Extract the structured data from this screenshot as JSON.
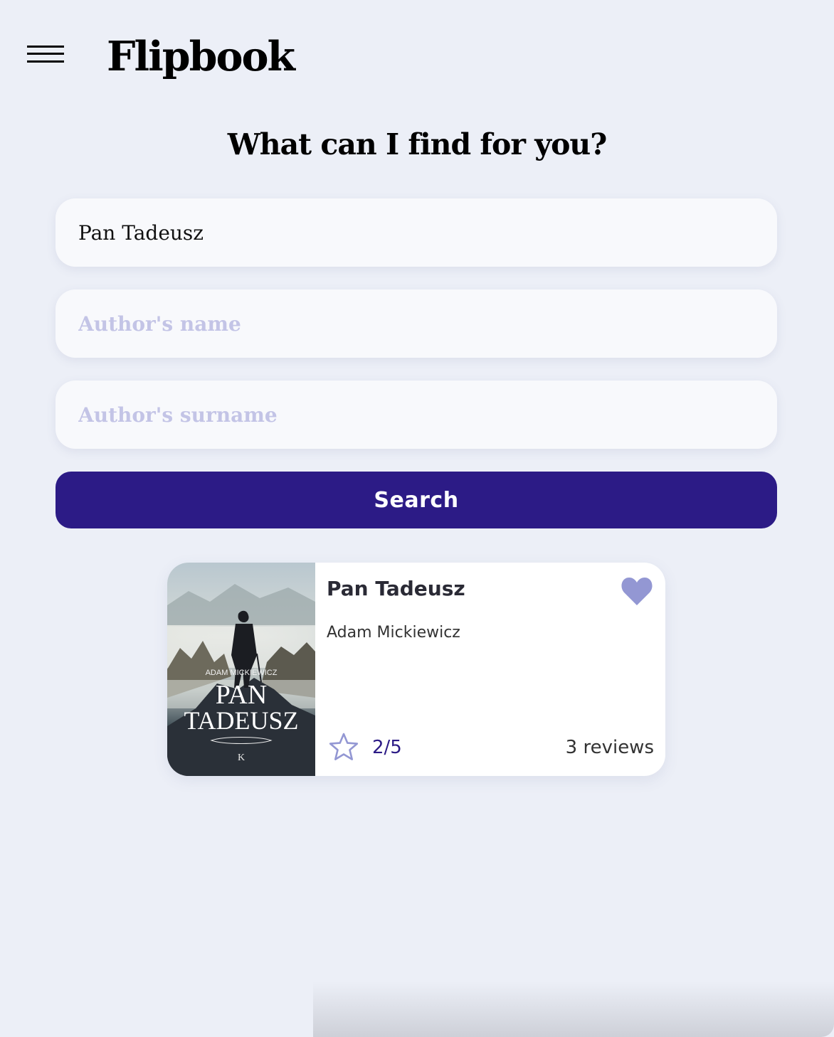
{
  "header": {
    "app_title": "Flipbook",
    "menu_icon": "hamburger-menu-icon"
  },
  "search": {
    "heading": "What can I find for you?",
    "title_value": "Pan Tadeusz",
    "author_name_placeholder": "Author's name",
    "author_surname_placeholder": "Author's surname",
    "button_label": "Search"
  },
  "results": [
    {
      "title": "Pan Tadeusz",
      "author": "Adam Mickiewicz",
      "rating": "2/5",
      "reviews": "3 reviews",
      "favorite_icon": "heart-icon",
      "rating_icon": "star-icon",
      "cover": {
        "author_text": "ADAM MICKIEWICZ",
        "title_line1": "PAN",
        "title_line2": "TADEUSZ",
        "publisher_mark": "K"
      }
    }
  ],
  "colors": {
    "background": "#eceff7",
    "accent": "#2c1b86",
    "icon": "#9397d3",
    "placeholder": "#c3c4e6"
  }
}
